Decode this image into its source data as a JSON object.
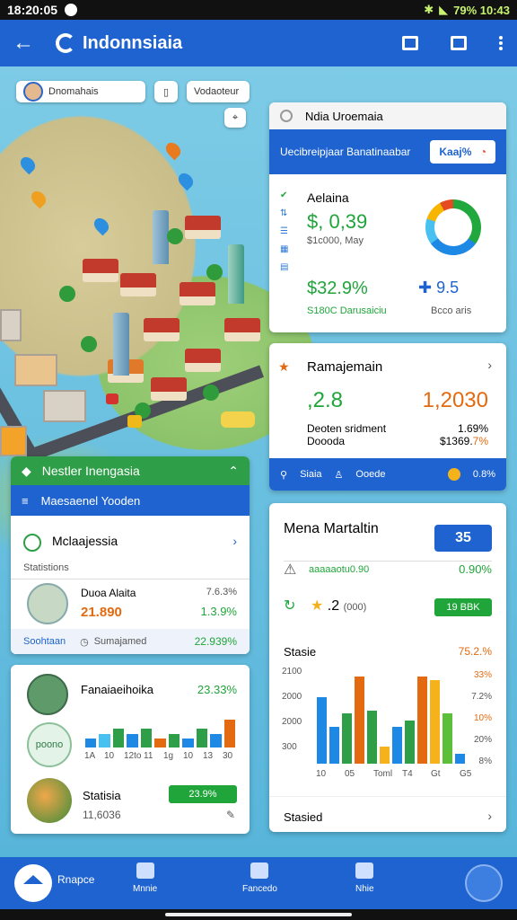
{
  "status": {
    "time": "18:20:05",
    "right": "79% 10:43"
  },
  "appbar": {
    "title": "Indonnsiaia"
  },
  "map": {
    "user_chip": "Dnomahais",
    "filter_chip": "Vodaoteur"
  },
  "card_region": {
    "header": "Ndia Uroemaia",
    "bluebar_text": "Uecibreipjaar Banatinaabar",
    "bluebar_button": "Kaaj%",
    "title": "Aelaina",
    "value": "$, 0,39",
    "sub": "$1c000, May",
    "value2": "$32.9%",
    "sub2": "S180C Darusaiciu",
    "value3": "9.5",
    "sub3": "Bcco aris",
    "donut": {
      "segments_pct": [
        35,
        30,
        15,
        12,
        8
      ],
      "colors": [
        "#21a83c",
        "#1e88e5",
        "#49c1f0",
        "#f7b500",
        "#e44b20"
      ]
    }
  },
  "card_ramajemain": {
    "title": "Ramajemain",
    "left_value": ",2.8",
    "right_value": "1,2030",
    "row1_label": "Deoten sridment",
    "row1_value": "1.69%",
    "row2_label": "Doooda",
    "row2_value": "$1369.",
    "row2_highlight": "7%",
    "footer_a": "Siaia",
    "footer_b": "Ooede",
    "footer_value": "0.8%"
  },
  "card_mana": {
    "title": "Mena Martaltin",
    "badge": "35",
    "row1_label": "aaaaaotu0.90",
    "row1_value": "0.90%",
    "row2_value": ".2",
    "row2_sub": "(000)",
    "row2_button": "19 BBK",
    "stats_title": "Stasie",
    "stats_pct": "75.2.%",
    "right_labels": [
      "33%",
      "7.2%",
      "10%",
      "20%",
      "8%"
    ],
    "footer": "Stasied"
  },
  "card_indonesia_left": {
    "green_header": "Nestler Inengasia",
    "blue_header": "Maesaenel Yooden",
    "section_title": "Mclaajessia",
    "statistics_label": "Statistions",
    "item_title": "Duoa Alaita",
    "item_value": "21.890",
    "item_value_right": "7.6.3%",
    "item_value_right2": "1.3.9%",
    "footer_left": "Soohtaan",
    "footer_mid": "Sumajamed",
    "footer_right": "22.939%"
  },
  "card_stats_left": {
    "title": "Fanaiaeihoika",
    "title_value": "23.33%",
    "statistic_label": "Statisia",
    "statistic_sub": "11,6036",
    "button": "23.9%",
    "badge": "poono"
  },
  "bottomnav": {
    "items": [
      "Rnapce",
      "Mnnie",
      "Fancedo",
      "Nhie"
    ]
  },
  "chart_data": [
    {
      "type": "bar",
      "title": "",
      "categories": [
        "10",
        "05",
        "Toml",
        "T4",
        "Gt",
        "G5"
      ],
      "series": [
        {
          "values": [
            2000,
            1100,
            1500,
            2600,
            1600,
            500,
            1100,
            1300,
            2600,
            2500,
            1500,
            300
          ]
        }
      ],
      "yticks": [
        "2100",
        "2000",
        "2000",
        "300"
      ],
      "ylim": [
        0,
        2800
      ]
    },
    {
      "type": "bar",
      "title": "",
      "categories": [
        "1A",
        "10",
        "12to",
        "11",
        "1g",
        "10",
        "13",
        "30"
      ],
      "series": [
        {
          "values": [
            2,
            3,
            4,
            3,
            4,
            2,
            3,
            2,
            4,
            3,
            6
          ]
        }
      ],
      "ylim": [
        0,
        7
      ]
    }
  ]
}
